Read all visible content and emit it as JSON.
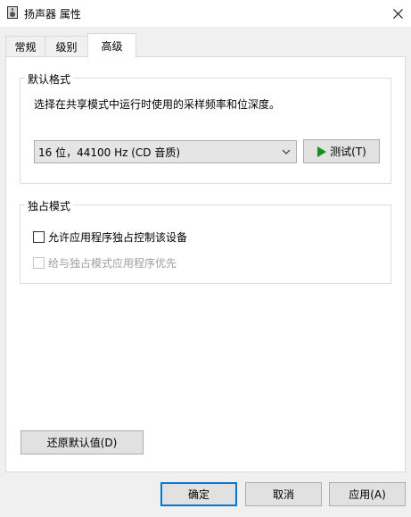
{
  "window": {
    "title": "扬声器 属性",
    "icon": "speaker-icon",
    "close_icon": "close-icon"
  },
  "tabs": [
    {
      "label": "常规",
      "active": false
    },
    {
      "label": "级别",
      "active": false
    },
    {
      "label": "高级",
      "active": true
    }
  ],
  "default_format": {
    "group_title": "默认格式",
    "description": "选择在共享模式中运行时使用的采样频率和位深度。",
    "selected_format": "16 位，44100 Hz (CD 音质)",
    "test_button_label": "测试(T)",
    "test_icon": "play-icon"
  },
  "exclusive_mode": {
    "group_title": "独占模式",
    "allow_exclusive_label": "允许应用程序独占控制该设备",
    "allow_exclusive_checked": false,
    "priority_label": "给与独占模式应用程序优先",
    "priority_checked": false,
    "priority_enabled": false
  },
  "restore_defaults_label": "还原默认值(D)",
  "footer": {
    "ok_label": "确定",
    "cancel_label": "取消",
    "apply_label": "应用(A)"
  },
  "colors": {
    "accent": "#0078d7",
    "play_green": "#1c8c1c"
  }
}
